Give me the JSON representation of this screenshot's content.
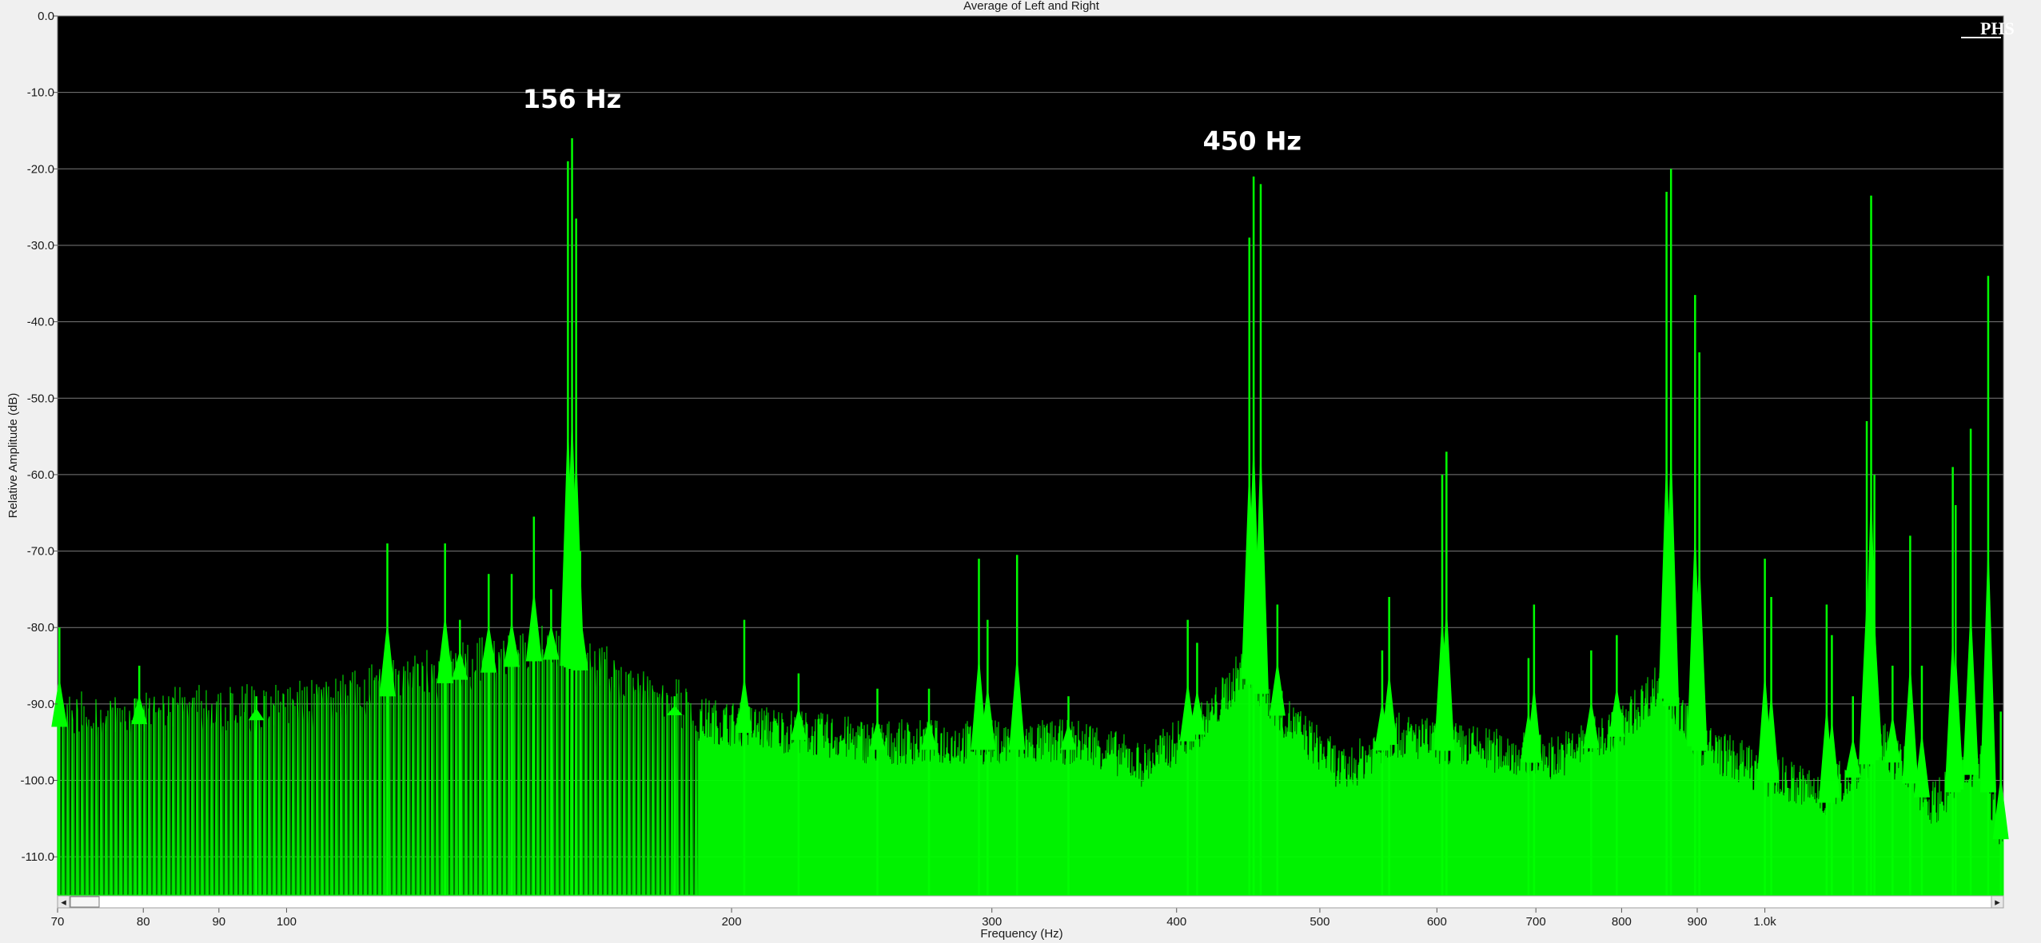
{
  "chart_data": {
    "type": "area",
    "title": "Average of Left and Right",
    "xlabel": "Frequency (Hz)",
    "ylabel": "Relative Amplitude (dB)",
    "x_scale": "log",
    "xlim": [
      70,
      1450
    ],
    "ylim": [
      -115,
      0
    ],
    "y_ticks": [
      0,
      -10,
      -20,
      -30,
      -40,
      -50,
      -60,
      -70,
      -80,
      -90,
      -100,
      -110
    ],
    "y_tick_labels": [
      "0.0",
      "-10.0",
      "-20.0",
      "-30.0",
      "-40.0",
      "-50.0",
      "-60.0",
      "-70.0",
      "-80.0",
      "-90.0",
      "-100.0",
      "-110.0"
    ],
    "x_ticks": [
      70,
      80,
      90,
      100,
      200,
      300,
      400,
      500,
      600,
      700,
      800,
      900,
      1000
    ],
    "x_tick_labels": [
      "70",
      "80",
      "90",
      "100",
      "200",
      "300",
      "400",
      "500",
      "600",
      "700",
      "800",
      "900",
      "1.0k"
    ],
    "grid": "horizontal",
    "annotations": [
      {
        "text": "156 Hz",
        "x": 156,
        "y": -12
      },
      {
        "text": "450 Hz",
        "x": 450,
        "y": -17.5
      }
    ],
    "noise_floor": [
      {
        "x": 70,
        "y": -93
      },
      {
        "x": 100,
        "y": -92
      },
      {
        "x": 130,
        "y": -87
      },
      {
        "x": 150,
        "y": -84
      },
      {
        "x": 160,
        "y": -86
      },
      {
        "x": 190,
        "y": -93
      },
      {
        "x": 250,
        "y": -96
      },
      {
        "x": 350,
        "y": -96
      },
      {
        "x": 380,
        "y": -99
      },
      {
        "x": 420,
        "y": -93
      },
      {
        "x": 445,
        "y": -86
      },
      {
        "x": 470,
        "y": -92
      },
      {
        "x": 520,
        "y": -100
      },
      {
        "x": 560,
        "y": -95
      },
      {
        "x": 650,
        "y": -97
      },
      {
        "x": 720,
        "y": -98
      },
      {
        "x": 800,
        "y": -94
      },
      {
        "x": 850,
        "y": -88
      },
      {
        "x": 900,
        "y": -96
      },
      {
        "x": 1000,
        "y": -100
      },
      {
        "x": 1100,
        "y": -103
      },
      {
        "x": 1200,
        "y": -96
      },
      {
        "x": 1300,
        "y": -104
      },
      {
        "x": 1400,
        "y": -98
      },
      {
        "x": 1450,
        "y": -109
      }
    ],
    "series": [
      {
        "values": [
          {
            "x": 70.2,
            "y": -80
          },
          {
            "x": 79.5,
            "y": -85
          },
          {
            "x": 95.4,
            "y": -89
          },
          {
            "x": 117,
            "y": -69
          },
          {
            "x": 128,
            "y": -69
          },
          {
            "x": 131,
            "y": -79
          },
          {
            "x": 137,
            "y": -73
          },
          {
            "x": 142,
            "y": -73
          },
          {
            "x": 147,
            "y": -65.5
          },
          {
            "x": 151,
            "y": -75
          },
          {
            "x": 155,
            "y": -19
          },
          {
            "x": 156,
            "y": -16
          },
          {
            "x": 157,
            "y": -26.5
          },
          {
            "x": 158,
            "y": -70
          },
          {
            "x": 183,
            "y": -89
          },
          {
            "x": 204,
            "y": -79
          },
          {
            "x": 222,
            "y": -86
          },
          {
            "x": 251,
            "y": -88
          },
          {
            "x": 272,
            "y": -88
          },
          {
            "x": 294,
            "y": -71
          },
          {
            "x": 298,
            "y": -79
          },
          {
            "x": 312,
            "y": -70.5
          },
          {
            "x": 338,
            "y": -89
          },
          {
            "x": 407,
            "y": -79
          },
          {
            "x": 413,
            "y": -82
          },
          {
            "x": 448,
            "y": -29
          },
          {
            "x": 451,
            "y": -21
          },
          {
            "x": 456,
            "y": -22
          },
          {
            "x": 468,
            "y": -77
          },
          {
            "x": 551,
            "y": -83
          },
          {
            "x": 557,
            "y": -76
          },
          {
            "x": 605,
            "y": -60
          },
          {
            "x": 609,
            "y": -57
          },
          {
            "x": 692,
            "y": -84
          },
          {
            "x": 698,
            "y": -77
          },
          {
            "x": 763,
            "y": -83
          },
          {
            "x": 794,
            "y": -81
          },
          {
            "x": 858,
            "y": -23
          },
          {
            "x": 864,
            "y": -20
          },
          {
            "x": 897,
            "y": -36.5
          },
          {
            "x": 903,
            "y": -44
          },
          {
            "x": 1000,
            "y": -71
          },
          {
            "x": 1010,
            "y": -76
          },
          {
            "x": 1101,
            "y": -77
          },
          {
            "x": 1110,
            "y": -81
          },
          {
            "x": 1147,
            "y": -89
          },
          {
            "x": 1172,
            "y": -53
          },
          {
            "x": 1180,
            "y": -23.5
          },
          {
            "x": 1186,
            "y": -60
          },
          {
            "x": 1220,
            "y": -85
          },
          {
            "x": 1254,
            "y": -68
          },
          {
            "x": 1277,
            "y": -85
          },
          {
            "x": 1340,
            "y": -59
          },
          {
            "x": 1346,
            "y": -64
          },
          {
            "x": 1378,
            "y": -54
          },
          {
            "x": 1416,
            "y": -34
          },
          {
            "x": 1444,
            "y": -91
          }
        ]
      }
    ],
    "colors": {
      "plot_background": "#000000",
      "spectrum": "#00ff00",
      "gridline": "#7a7a7a",
      "annotation": "#ffffff",
      "window_background": "#f0f0f0"
    }
  },
  "scrollbar": {
    "left_arrow_icon": "◂",
    "right_arrow_icon": "▸"
  },
  "logo": {
    "text": "PHS"
  }
}
